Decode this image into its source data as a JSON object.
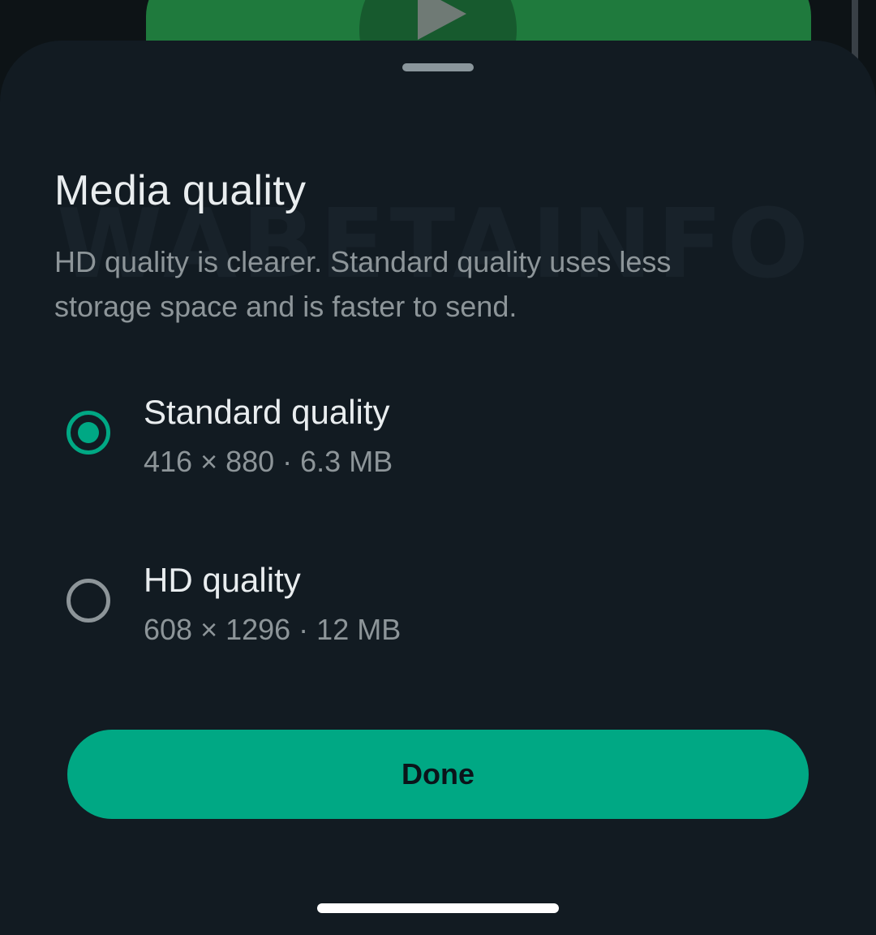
{
  "background": {
    "play_icon": "play-icon",
    "accent_color": "#1f7a3d"
  },
  "sheet": {
    "title": "Media quality",
    "description": "HD quality is clearer. Standard quality uses less storage space and is faster to send.",
    "watermark": "WABETAINFO",
    "options": [
      {
        "label": "Standard quality",
        "detail": "416 × 880 · 6.3 MB",
        "selected": true
      },
      {
        "label": "HD quality",
        "detail": "608 × 1296 · 12 MB",
        "selected": false
      }
    ],
    "done_label": "Done"
  },
  "colors": {
    "accent": "#00a884",
    "sheet_background": "#121b22",
    "primary_text": "#e9edef",
    "secondary_text": "#8d9599"
  }
}
